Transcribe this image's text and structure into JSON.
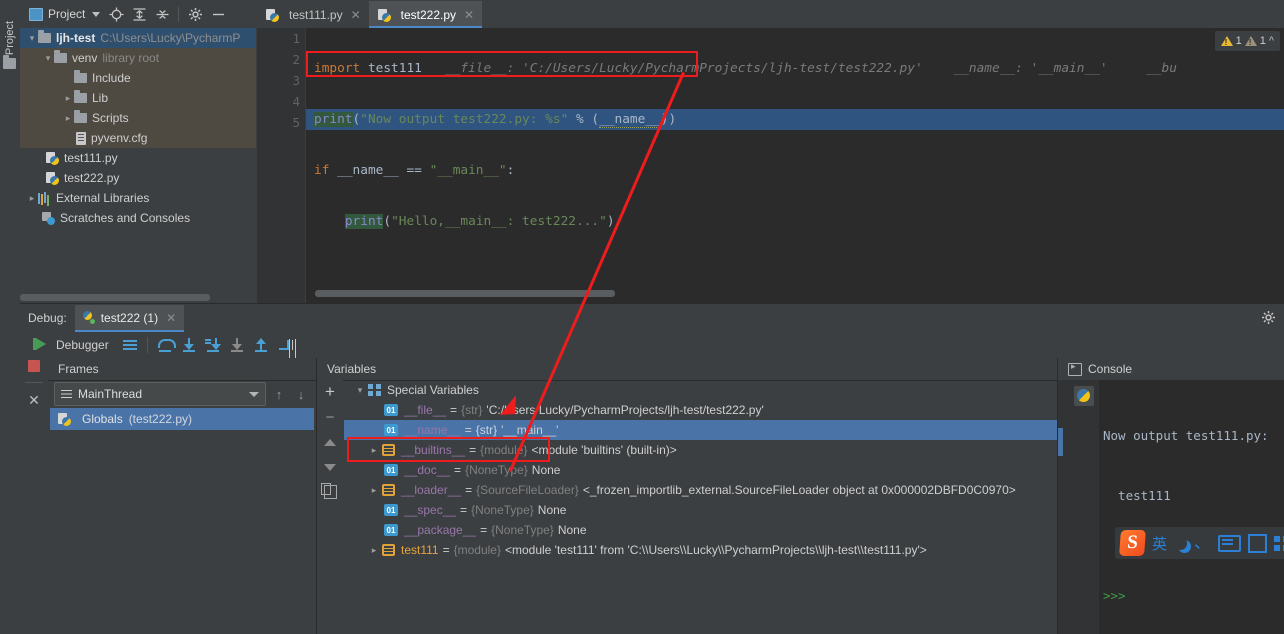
{
  "window": {
    "left_strip_tab": "Project"
  },
  "project_panel": {
    "title": "Project",
    "toolbar_icons": [
      "locate-icon",
      "expand-all-icon",
      "collapse-all-icon",
      "gear-icon",
      "minimize-icon"
    ],
    "tree": [
      {
        "label": "ljh-test",
        "detail": "C:\\Users\\Lucky\\PycharmP",
        "icon": "folder-icon",
        "arrow": "open",
        "depth": 0,
        "state": "selected"
      },
      {
        "label": "venv",
        "detail": "library root",
        "icon": "folder-icon",
        "arrow": "open",
        "depth": 1,
        "state": "highlight"
      },
      {
        "label": "Include",
        "detail": "",
        "icon": "folder-icon",
        "arrow": "none",
        "depth": 2,
        "state": "highlight"
      },
      {
        "label": "Lib",
        "detail": "",
        "icon": "folder-icon",
        "arrow": "closed",
        "depth": 2,
        "state": "highlight"
      },
      {
        "label": "Scripts",
        "detail": "",
        "icon": "folder-icon",
        "arrow": "closed",
        "depth": 2,
        "state": "highlight"
      },
      {
        "label": "pyvenv.cfg",
        "detail": "",
        "icon": "config-file-icon",
        "arrow": "none",
        "depth": 2,
        "state": "highlight"
      },
      {
        "label": "test111.py",
        "detail": "",
        "icon": "python-file-icon",
        "arrow": "none",
        "depth": 1,
        "state": "normal"
      },
      {
        "label": "test222.py",
        "detail": "",
        "icon": "python-file-icon",
        "arrow": "none",
        "depth": 1,
        "state": "normal"
      },
      {
        "label": "External Libraries",
        "detail": "",
        "icon": "library-icon",
        "arrow": "closed",
        "depth": 0,
        "state": "normal"
      },
      {
        "label": "Scratches and Consoles",
        "detail": "",
        "icon": "scratches-icon",
        "arrow": "none",
        "depth": 0,
        "state": "normal"
      }
    ]
  },
  "editor": {
    "tabs": [
      {
        "label": "test111.py",
        "active": false
      },
      {
        "label": "test222.py",
        "active": true
      }
    ],
    "line_numbers": [
      "1",
      "2",
      "3",
      "4",
      "5"
    ],
    "code_lines": [
      "import test111",
      "print(\"Now output test222.py: %s\" % (__name__))",
      "if __name__ == \"__main__\":",
      "    print(\"Hello,__main__: test222...\")",
      ""
    ],
    "inline_hints": [
      "__file__: 'C:/Users/Lucky/PycharmProjects/ljh-test/test222.py'",
      "__name__: '__main__'",
      "__bu"
    ],
    "highlighted_line": 2,
    "warnings": {
      "warning_count": "1",
      "weak_warning_count": "1"
    },
    "colors": {
      "keyword": "#cc7832",
      "string": "#6a8759",
      "function": "#ffc66d",
      "default_text": "#a9b7c6",
      "selection": "#2f5480",
      "background": "#2b2b2b"
    }
  },
  "debug": {
    "header_label": "Debug:",
    "session_tab": "test222 (1)",
    "toolbar_label": "Debugger",
    "toolbar_icons": [
      "resume-program-icon",
      "stop-icon",
      "close-icon",
      "frames-icon",
      "step-over-icon",
      "step-into-icon",
      "force-step-into-icon",
      "step-into-my-code-icon",
      "step-out-icon",
      "run-to-cursor-icon"
    ],
    "frames": {
      "title": "Frames",
      "thread": "MainThread",
      "items": [
        {
          "label": "Globals",
          "detail": "(test222.py)",
          "selected": true
        }
      ]
    },
    "variables": {
      "title": "Variables",
      "toolbar_icons": [
        "add-watch-icon",
        "remove-watch-icon",
        "move-up-icon",
        "move-down-icon",
        "copy-value-icon"
      ],
      "rows": [
        {
          "arrow": "open",
          "icon": "special-variables-icon",
          "name": "Special Variables",
          "type": "",
          "value": "",
          "depth": 0,
          "selected": false,
          "group": true
        },
        {
          "arrow": "none",
          "icon": "primitive-value-icon",
          "name": "__file__",
          "type": "{str}",
          "value": "'C:/Users/Lucky/PycharmProjects/ljh-test/test222.py'",
          "depth": 1,
          "selected": false
        },
        {
          "arrow": "none",
          "icon": "primitive-value-icon",
          "name": "__name__",
          "type": "{str}",
          "value": "'__main__'",
          "depth": 1,
          "selected": true
        },
        {
          "arrow": "closed",
          "icon": "module-icon",
          "name": "__builtins__",
          "type": "{module}",
          "value": "<module 'builtins' (built-in)>",
          "depth": 1,
          "selected": false
        },
        {
          "arrow": "none",
          "icon": "primitive-value-icon",
          "name": "__doc__",
          "type": "{NoneType}",
          "value": "None",
          "depth": 1,
          "selected": false
        },
        {
          "arrow": "closed",
          "icon": "module-icon",
          "name": "__loader__",
          "type": "{SourceFileLoader}",
          "value": "<_frozen_importlib_external.SourceFileLoader object at 0x000002DBFD0C0970>",
          "depth": 1,
          "selected": false
        },
        {
          "arrow": "none",
          "icon": "primitive-value-icon",
          "name": "__spec__",
          "type": "{NoneType}",
          "value": "None",
          "depth": 1,
          "selected": false
        },
        {
          "arrow": "none",
          "icon": "primitive-value-icon",
          "name": "__package__",
          "type": "{NoneType}",
          "value": "None",
          "depth": 1,
          "selected": false
        },
        {
          "arrow": "closed",
          "icon": "module-icon",
          "name": "test111",
          "type": "{module}",
          "value": "<module 'test111' from 'C:\\\\Users\\\\Lucky\\\\PycharmProjects\\\\ljh-test\\\\test111.py'>",
          "depth": 1,
          "selected": false
        }
      ]
    },
    "console": {
      "title": "Console",
      "output_lines": [
        "Now output test111.py:",
        "  test111",
        "",
        ""
      ],
      "prompt": ">>>"
    }
  },
  "ime": {
    "logo": "S",
    "mode": "英",
    "items": [
      "sogou-logo-icon",
      "english-mode-icon",
      "moon-icon",
      "comma-icon",
      "keyboard-icon",
      "screenshot-icon",
      "toolbox-icon"
    ]
  },
  "annotations": {
    "color": "#ee1c1c",
    "boxes": [
      "code-line-2-highlight-box",
      "name-variable-highlight-box"
    ],
    "connector": "arrow-from-code-to-variable"
  }
}
